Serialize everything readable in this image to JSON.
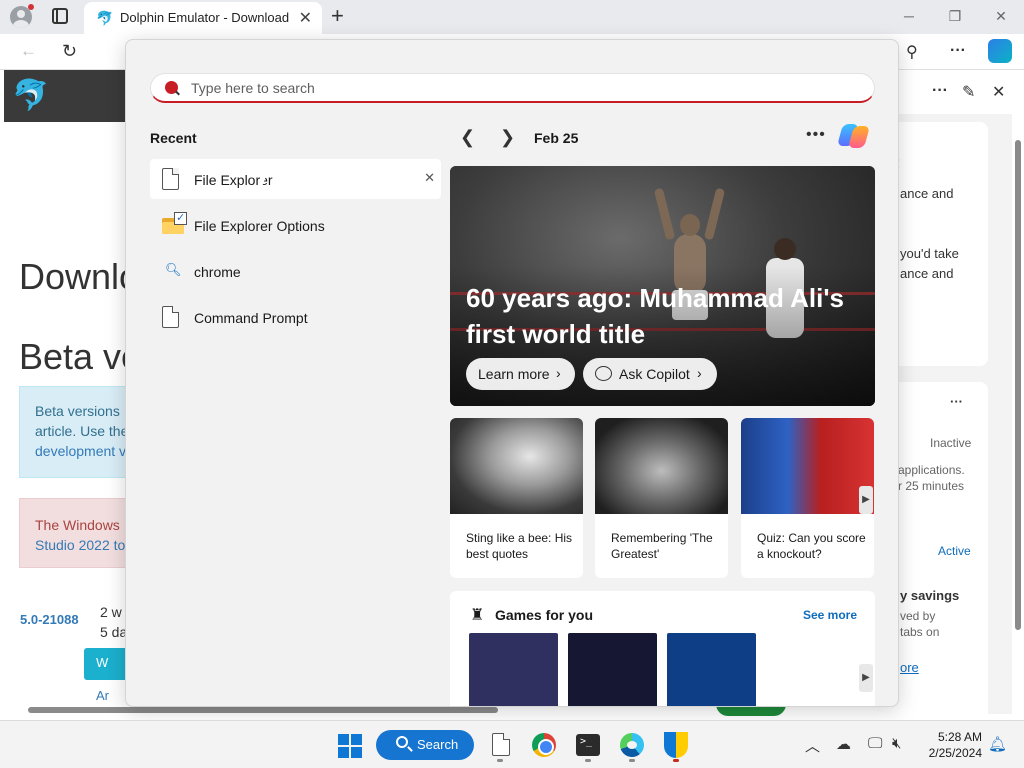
{
  "browser": {
    "tab_title": "Dolphin Emulator - Download",
    "new_tab_glyph": "+",
    "tab_close_glyph": "✕"
  },
  "page": {
    "heading_download": "Downlo",
    "heading_beta": "Beta ve",
    "info_line1": "Beta versions",
    "info_line2": "article. Use the",
    "info_line3": "development v",
    "warn_line1": "The Windows",
    "warn_line2": "Studio 2022 to",
    "version_link": "5.0-21088",
    "version_date_line1": "2 w",
    "version_date_line2": "5 da",
    "download_btn": "W",
    "small_link": "Ar"
  },
  "sidepane": {
    "line_1": "!",
    "line_2": "ance and",
    "line_3": "you'd take",
    "line_4": "ance and",
    "status_inactive": "Inactive",
    "apps_line1": "applications.",
    "apps_line2": "r 25 minutes",
    "status_active": "Active",
    "savings_title": "y savings",
    "savings_line1": "ved by",
    "savings_line2": "tabs on",
    "savings_link": "ore"
  },
  "flyout": {
    "search": {
      "placeholder": "Type here to search",
      "value": ""
    },
    "recent_label": "Recent",
    "recent_items": [
      {
        "label": "File Explorer",
        "icon": "document-icon"
      },
      {
        "label": "File Explorer Options",
        "icon": "folder-options-icon"
      },
      {
        "label": "chrome",
        "icon": "search-icon"
      },
      {
        "label": "Command Prompt",
        "icon": "document-icon"
      }
    ],
    "remove_glyph": "✕",
    "date_label": "Feb 25",
    "hero": {
      "title": "60 years ago: Muhammad Ali's first world title",
      "learn_more": "Learn more",
      "ask_copilot": "Ask Copilot"
    },
    "stories": [
      {
        "text": "Sting like a bee: His best quotes"
      },
      {
        "text": "Remembering 'The Greatest'"
      },
      {
        "text": "Quiz: Can you score a knockout?"
      }
    ],
    "games": {
      "title": "Games for you",
      "see_more": "See more",
      "tile_colors": [
        "#2f3060",
        "#161733",
        "#0e3f86"
      ]
    }
  },
  "taskbar": {
    "search_label": "Search",
    "time": "5:28 AM",
    "date": "2/25/2024"
  },
  "colors": {
    "accent": "#0f6cbd",
    "search_accent": "#c81d25",
    "taskbar_search": "#1675d1"
  }
}
